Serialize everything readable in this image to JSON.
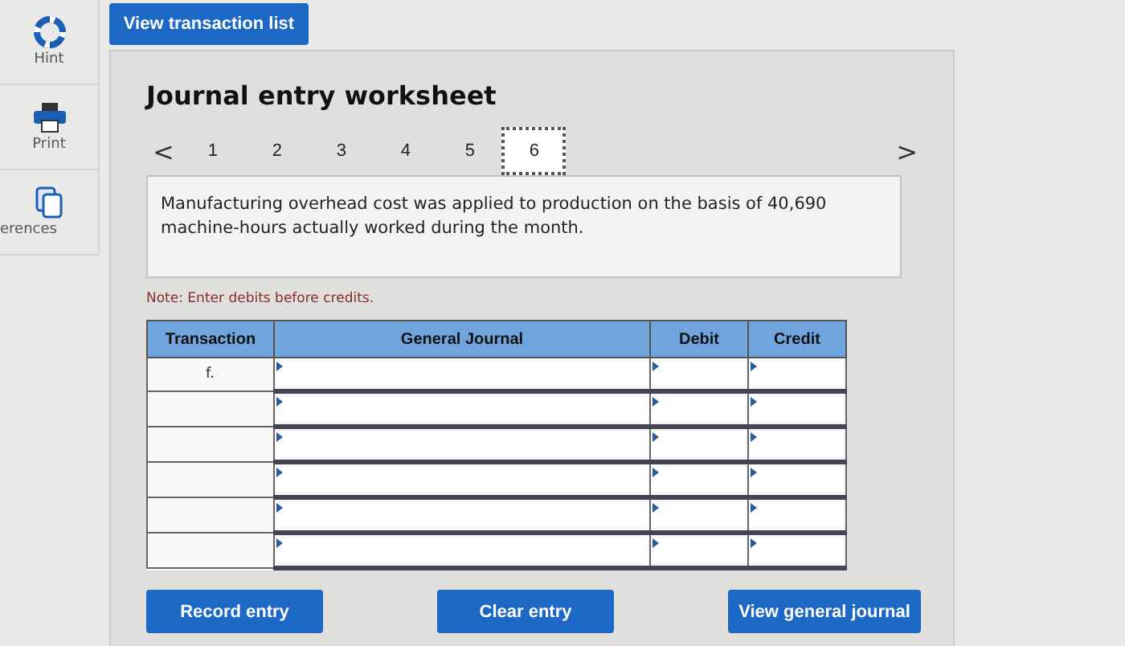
{
  "sidebar": {
    "items": [
      {
        "label": "Hint",
        "kind": "hint"
      },
      {
        "label": "Print",
        "kind": "print"
      },
      {
        "label": "erences",
        "kind": "references"
      }
    ]
  },
  "top_button": "View transaction list",
  "worksheet": {
    "title": "Journal entry worksheet",
    "prev": "<",
    "next": ">",
    "pages": [
      {
        "label": "1",
        "selected": false
      },
      {
        "label": "2",
        "selected": false
      },
      {
        "label": "3",
        "selected": false
      },
      {
        "label": "4",
        "selected": false
      },
      {
        "label": "5",
        "selected": false
      },
      {
        "label": "6",
        "selected": true
      }
    ],
    "description": "Manufacturing overhead cost was applied to production on the basis of 40,690 machine-hours actually worked during the month.",
    "note": "Note: Enter debits before credits.",
    "table": {
      "columns": [
        "Transaction",
        "General Journal",
        "Debit",
        "Credit"
      ],
      "rows": [
        {
          "transaction": "f."
        },
        {},
        {},
        {},
        {},
        {}
      ]
    },
    "buttons": [
      "Record entry",
      "Clear entry",
      "View general journal"
    ]
  }
}
